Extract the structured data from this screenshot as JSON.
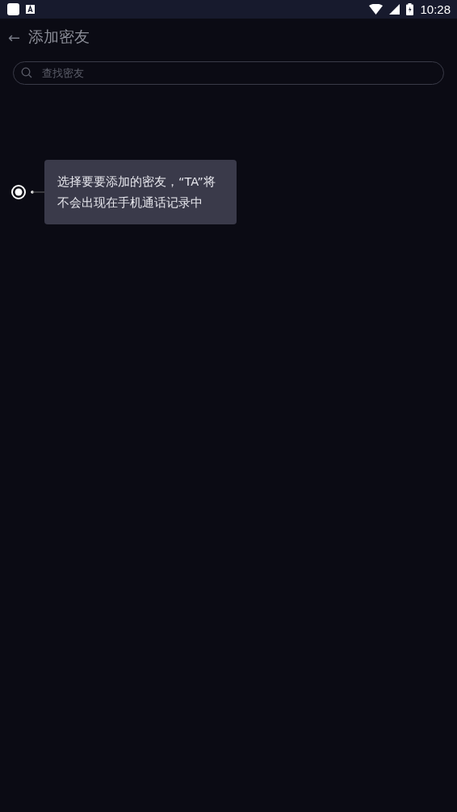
{
  "status_bar": {
    "time": "10:28"
  },
  "header": {
    "back_icon": "←",
    "title": "添加密友"
  },
  "search": {
    "placeholder": "查找密友"
  },
  "tooltip": {
    "text": "选择要要添加的密友，“TA”将不会出现在手机通话记录中"
  }
}
